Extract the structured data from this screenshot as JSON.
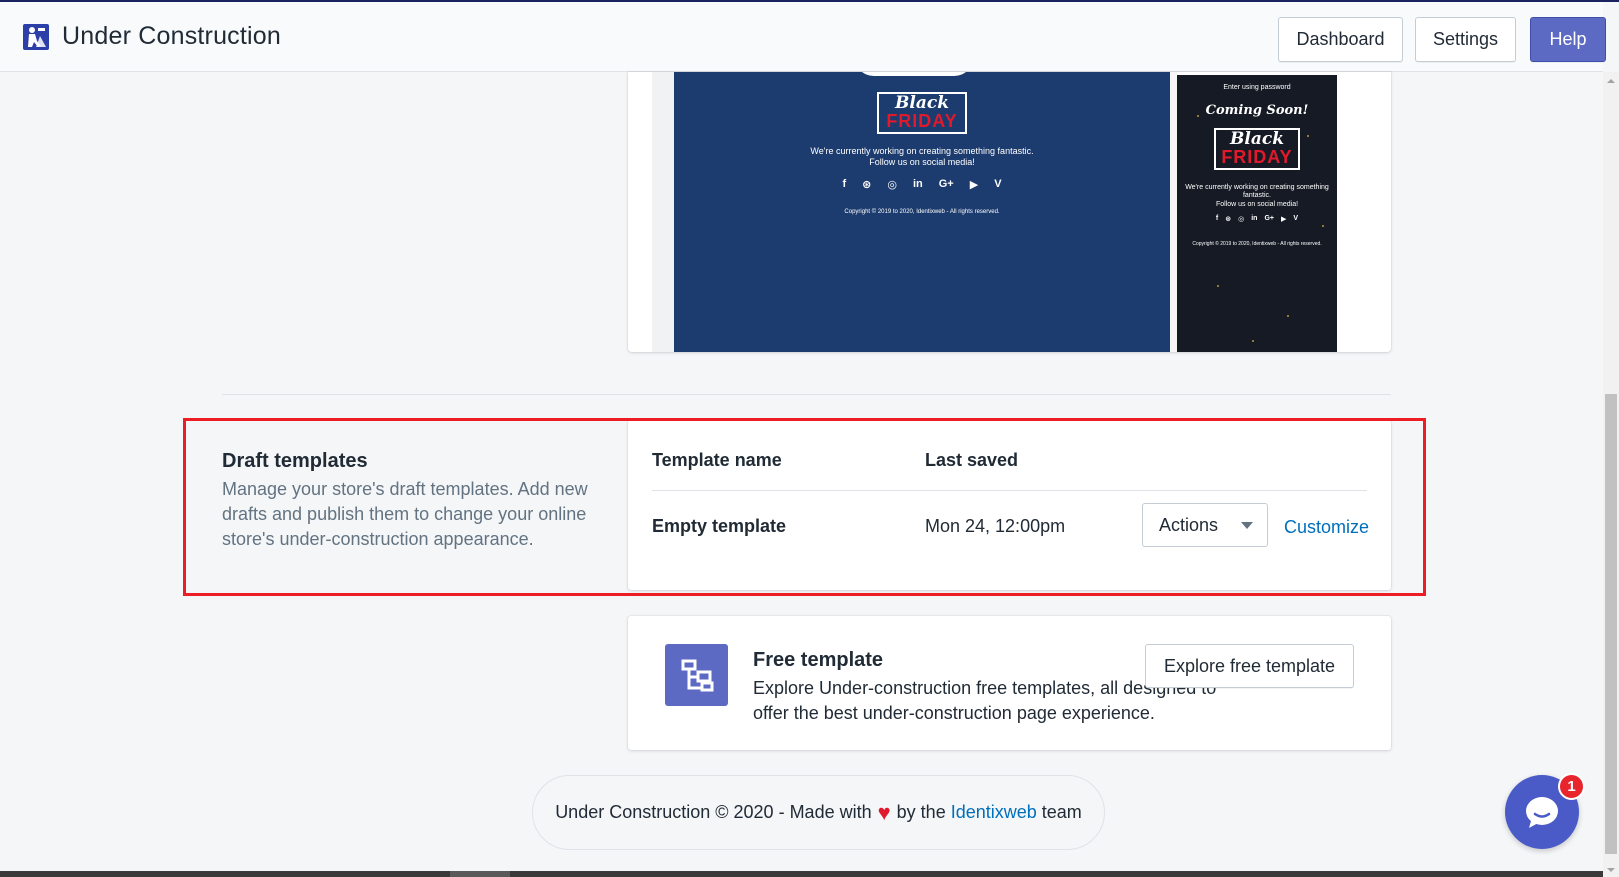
{
  "header": {
    "app_title": "Under Construction",
    "logo_icon": "construction-worker-icon",
    "buttons": {
      "dashboard": "Dashboard",
      "settings": "Settings",
      "help": "Help"
    },
    "accent_color": "#5c6ac4"
  },
  "preview": {
    "desktop": {
      "badge_top": "Black",
      "badge_bottom": "FRIDAY",
      "text_line1": "We're currently working on creating something fantastic.",
      "text_line2": "Follow us on social media!",
      "social": [
        "f",
        "⊛",
        "◎",
        "in",
        "G+",
        "▶",
        "V"
      ],
      "copyright": "Copyright © 2019 to 2020, Identixweb - All rights reserved.",
      "background_color": "#1c3b6e"
    },
    "mobile": {
      "top_text": "Enter using password",
      "coming_soon": "Coming Soon!",
      "badge_top": "Black",
      "badge_bottom": "FRIDAY",
      "text_line1": "We're currently working on creating something fantastic.",
      "text_line2": "Follow us on social media!",
      "social": [
        "f",
        "⊛",
        "◎",
        "in",
        "G+",
        "▶",
        "V"
      ],
      "copyright": "Copyright © 2019 to 2020, Identixweb - All rights reserved."
    }
  },
  "draft": {
    "title": "Draft templates",
    "description": "Manage your store's draft templates. Add new drafts and publish them to change your online store's under-construction appearance.",
    "columns": [
      "Template name",
      "Last saved"
    ],
    "rows": [
      {
        "name": "Empty template",
        "last_saved": "Mon 24, 12:00pm",
        "actions_label": "Actions",
        "customize_label": "Customize"
      }
    ],
    "highlight_color": "#ee1c25"
  },
  "free_template": {
    "icon": "template-icon",
    "title": "Free template",
    "description": "Explore Under-construction free templates, all designed to offer the best under-construction page experience.",
    "button": "Explore free template"
  },
  "footer": {
    "text_before": "Under Construction © 2020 - Made with",
    "heart": "♥",
    "text_by": "by the",
    "link": "Identixweb",
    "text_after": "team"
  },
  "chat": {
    "icon": "chat-bubble-icon",
    "badge_count": "1"
  }
}
